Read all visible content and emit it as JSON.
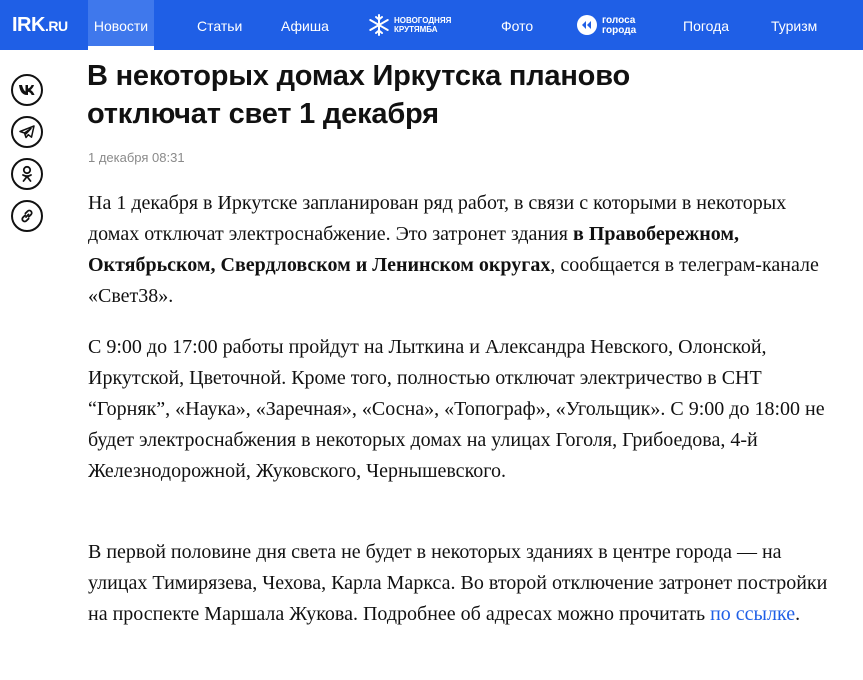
{
  "header": {
    "logo": "IRK",
    "logo_suffix": ".RU",
    "nav": [
      {
        "label": "Новости"
      },
      {
        "label": "Статьи"
      },
      {
        "label": "Афиша"
      },
      {
        "label": "Фото"
      },
      {
        "label": "Погода"
      },
      {
        "label": "Туризм"
      }
    ],
    "promo_krutyamba": {
      "line1": "НОВОГОДНЯЯ",
      "line2": "КРУТЯМБА"
    },
    "promo_golosa": {
      "line1": "голоса",
      "line2": "города"
    }
  },
  "share": {
    "items": [
      "vk-icon",
      "telegram-icon",
      "odnoklassniki-icon",
      "link-icon"
    ]
  },
  "article": {
    "title_line1": "В некоторых домах Иркутска планово",
    "title_line2": "отключат свет 1 декабря",
    "date": "1 декабря 08:31",
    "p1_a": "На 1 декабря в Иркутске запланирован ряд работ, в связи с которыми в некоторых домах отключат электроснабжение. Это затронет здания ",
    "p1_bold": "в Правобережном, Октябрьском, Свердловском и Ленинском округах",
    "p1_b": ", сообщается в телеграм-канале «Свет38».",
    "p2": "С 9:00 до 17:00 работы пройдут на Лыткина и Александра Невского, Олонской, Иркутской, Цветочной. Кроме того, полностью отключат электричество в СНТ “Горняк”, «Наука», «Заречная», «Сосна», «Топограф», «Угольщик». С 9:00 до 18:00 не будет электроснабжения в некоторых домах на улицах Гоголя, Грибоедова, 4-й Железнодорожной, Жуковского, Чернышевского.",
    "p3_a": "В первой половине дня света не будет в некоторых зданиях в центре города — на улицах Тимирязева, Чехова, Карла Маркса. Во второй отключение затронет постройки на проспекте Маршала Жукова. Подробнее об адресах можно прочитать ",
    "p3_link": "по ссылке",
    "p3_b": "."
  }
}
